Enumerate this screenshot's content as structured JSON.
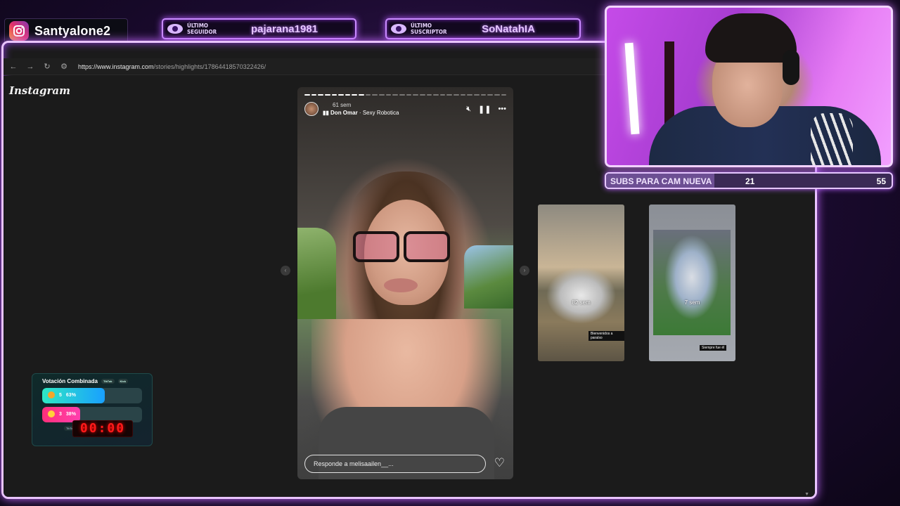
{
  "overlay": {
    "instagram_handle": "Santyalone2",
    "last_follower": {
      "label": "Último Seguidor",
      "value": "pajarana1981"
    },
    "last_subscriber": {
      "label": "Último Suscriptor",
      "value": "SoNatahIA"
    }
  },
  "browser": {
    "url_host": "https://www.instagram.com",
    "url_path": "/stories/highlights/17864418570322426/"
  },
  "instagram": {
    "wordmark": "Instagram",
    "story": {
      "time": "61 sem",
      "song_artist": "Don Omar",
      "song_title": " · Sexy Robotica",
      "reply_placeholder": "Responde a melisaailen__...",
      "progress_segments": 30,
      "progress_done": 9
    },
    "highlights": [
      {
        "time": "82 sem",
        "tag": "Bienvenidos a paraíso"
      },
      {
        "time": "7 sem",
        "tag": "Siempre fue él"
      }
    ]
  },
  "vote": {
    "title": "Votación Combinada",
    "chips": [
      "TikTok",
      "Kick"
    ],
    "options": [
      {
        "count": "5",
        "percent": "63%",
        "fill": 0.63,
        "color": "#2fe8c4"
      },
      {
        "count": "3",
        "percent": "38%",
        "fill": 0.38,
        "color": "#ff2f7a"
      }
    ],
    "footer": [
      "TikTok: 5 / 3",
      "Kick: 0 / 0",
      "Reset: 0"
    ]
  },
  "timer": "00:00",
  "subs_goal": {
    "label": "SUBS PARA CAM NUEVA",
    "current": "21",
    "goal": "55",
    "progress": 0.38
  }
}
